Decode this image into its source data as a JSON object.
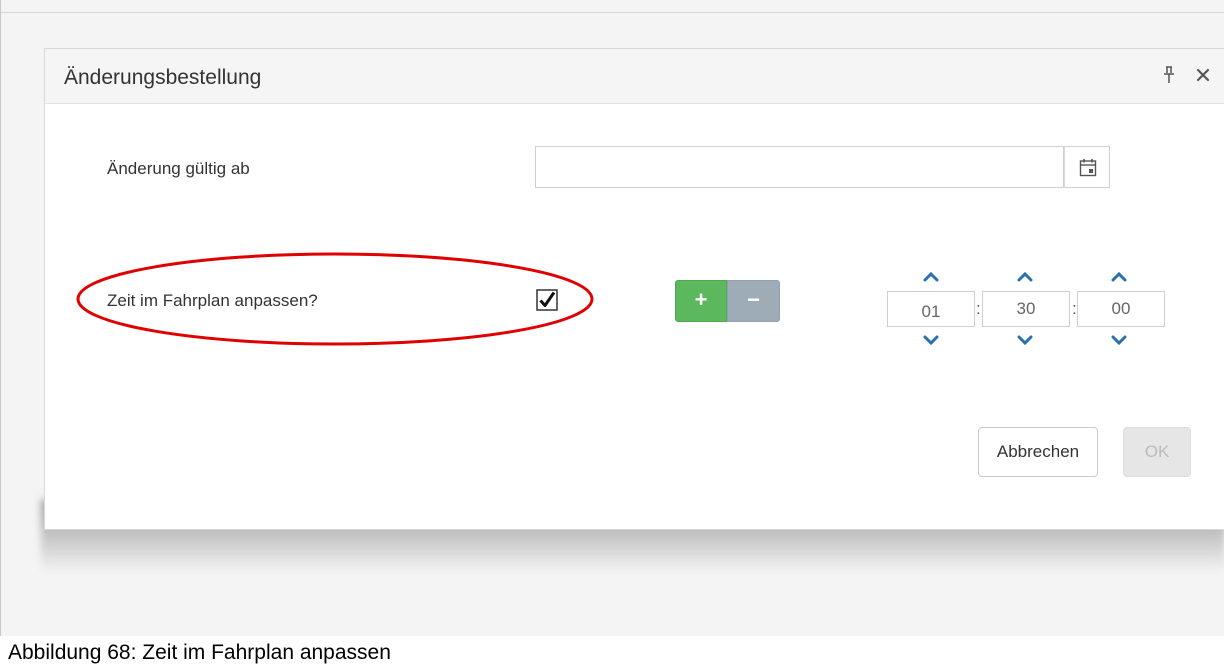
{
  "dialog": {
    "title": "Änderungsbestellung",
    "pin_icon": "pin-icon",
    "close_icon": "close-icon"
  },
  "form": {
    "valid_from_label": "Änderung gültig ab",
    "valid_from_value": "",
    "calendar_icon": "calendar-icon",
    "adjust_time_label": "Zeit im Fahrplan anpassen?",
    "adjust_time_checked": true,
    "plus_label": "+",
    "minus_label": "−",
    "time": {
      "hours": "01",
      "minutes": "30",
      "seconds": "00",
      "separator": ":"
    }
  },
  "buttons": {
    "cancel": "Abbrechen",
    "ok": "OK"
  },
  "colors": {
    "plus_green": "#5cb85c",
    "minus_gray": "#9eacb8",
    "spinner_blue": "#2a6fb0",
    "highlight_red": "#e00000"
  },
  "caption": "Abbildung 68: Zeit im Fahrplan anpassen"
}
